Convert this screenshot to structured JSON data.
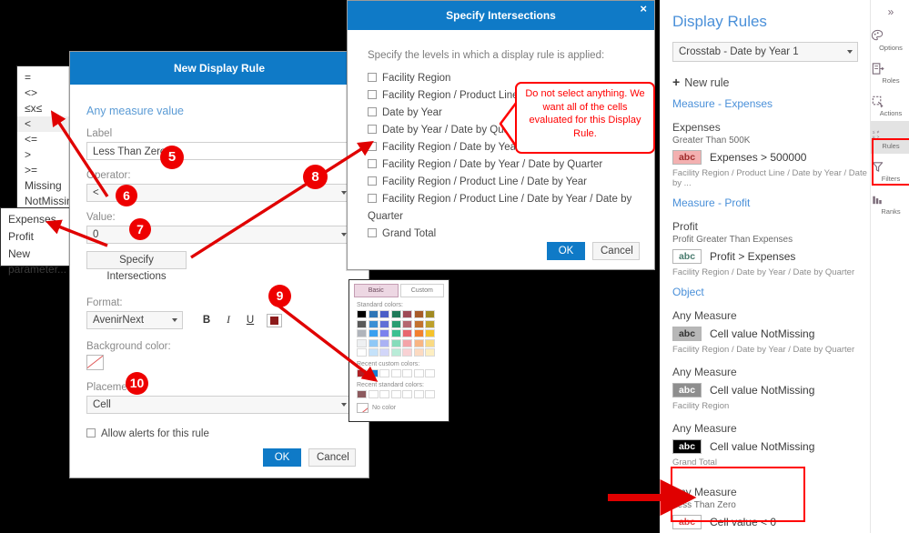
{
  "operator_dropdown": {
    "name": "Operator options",
    "options": [
      "=",
      "<>",
      "≤x≤",
      "<",
      "<=",
      ">",
      ">=",
      "Missing",
      "NotMissing"
    ],
    "selected": "<"
  },
  "value_dropdown": {
    "options": [
      "Expenses",
      "Profit",
      "New parameter..."
    ]
  },
  "new_display_rule": {
    "title": "New Display Rule",
    "any_measure_value": "Any measure value",
    "label_caption": "Label",
    "label_value": "Less Than Zero",
    "operator_caption": "Operator:",
    "operator_value": "<",
    "value_caption": "Value:",
    "value_value": "0",
    "specify_intersections_button": "Specify Intersections",
    "format_caption": "Format:",
    "font_value": "AvenirNext",
    "bold": "B",
    "italic": "I",
    "underline": "U",
    "font_color": "#8c1b1b",
    "background_caption": "Background color:",
    "background_value": "No color",
    "placement_caption": "Placement:",
    "placement_value": "Cell",
    "alerts_checkbox": "Allow alerts for this rule",
    "ok": "OK",
    "cancel": "Cancel"
  },
  "specify_intersections": {
    "title": "Specify Intersections",
    "close": "×",
    "instruction": "Specify the levels in which a display rule is applied:",
    "levels": [
      "Facility Region",
      "Facility Region / Product Line",
      "Date by Year",
      "Date by Year / Date by Quarter",
      "Facility Region / Date by Year",
      "Facility Region / Date by Year / Date by Quarter",
      "Facility Region / Product Line / Date by Year",
      "Facility Region / Product Line / Date by Year / Date by Quarter",
      "Grand Total"
    ],
    "ok": "OK",
    "cancel": "Cancel"
  },
  "callout": {
    "text": "Do not select anything.  We want all of the cells evaluated for this Display Rule.",
    "color": "#ff0000"
  },
  "color_picker": {
    "tab_basic": "Basic",
    "tab_custom": "Custom",
    "standard_caption": "Standard colors:",
    "standard_colors": [
      [
        "#000000",
        "#2e75b6",
        "#4a5ec7",
        "#1f7a5a",
        "#9e4a55",
        "#a75a28",
        "#a18a22"
      ],
      [
        "#595959",
        "#3b8fd4",
        "#5f6fd6",
        "#2a9c72",
        "#b4666f",
        "#c2712f",
        "#bda02c"
      ],
      [
        "#b0b4bb",
        "#3aa0f0",
        "#7b82ee",
        "#3cc091",
        "#e8666f",
        "#f2802f",
        "#f5c22b"
      ],
      [
        "#eef0f2",
        "#8fc8f6",
        "#aab2f4",
        "#86dcbb",
        "#f4a3a8",
        "#f8b583",
        "#f9da83"
      ],
      [
        "#ffffff",
        "#c5e2fa",
        "#d2d6f9",
        "#b9ecd8",
        "#f9d1d4",
        "#fcdac1",
        "#fdeec1"
      ]
    ],
    "recent_custom_caption": "Recent custom colors:",
    "recent_custom": [
      "#b01f24",
      "#1a7fd4",
      "",
      "",
      "",
      "",
      ""
    ],
    "recent_standard_caption": "Recent standard colors:",
    "recent_standard": [
      "#8c5a5e",
      "",
      "",
      "",
      "",
      "",
      ""
    ],
    "no_color": "No color"
  },
  "display_rules_panel": {
    "title": "Display Rules",
    "object_select": "Crosstab - Date by Year 1",
    "new_rule": "New rule",
    "groups": [
      {
        "header": "Measure - Expenses",
        "rules": [
          {
            "measure": "Expenses",
            "sub": "Greater Than 500K",
            "badge": "abc",
            "badge_bg": "#f3b0b0",
            "badge_fg": "#9e2a2a",
            "text": "Expenses > 500000",
            "path": "Facility Region / Product Line / Date by Year / Date by ..."
          }
        ]
      },
      {
        "header": "Measure - Profit",
        "rules": [
          {
            "measure": "Profit",
            "sub": "Profit Greater Than Expenses",
            "badge": "abc",
            "badge_bg": "#ffffff",
            "badge_fg": "#4a7c6f",
            "text": "Profit > Expenses",
            "path": "Facility Region / Date by Year / Date by Quarter"
          }
        ]
      },
      {
        "header": "Object",
        "rules": [
          {
            "measure": "Any Measure",
            "sub": "",
            "badge": "abc",
            "badge_bg": "#b7b7b7",
            "badge_fg": "#333333",
            "text": "Cell value NotMissing",
            "path": "Facility Region / Date by Year / Date by Quarter"
          },
          {
            "measure": "Any Measure",
            "sub": "",
            "badge": "abc",
            "badge_bg": "#8e8e8e",
            "badge_fg": "#ffffff",
            "text": "Cell value NotMissing",
            "path": "Facility Region"
          },
          {
            "measure": "Any Measure",
            "sub": "",
            "badge": "abc",
            "badge_bg": "#000000",
            "badge_fg": "#ffffff",
            "text": "Cell value NotMissing",
            "path": "Grand Total"
          },
          {
            "measure": "Any Measure",
            "sub": "Less Than Zero",
            "badge": "abc",
            "badge_bg": "#ffffff",
            "badge_fg": "#d04a4a",
            "text": "Cell value < 0",
            "path": ""
          }
        ]
      }
    ]
  },
  "rail": {
    "expand": "»",
    "items": [
      {
        "icon": "palette-icon",
        "label": "Options"
      },
      {
        "icon": "roles-icon",
        "label": "Roles"
      },
      {
        "icon": "actions-icon",
        "label": "Actions"
      },
      {
        "icon": "rules-icon",
        "label": "Rules"
      },
      {
        "icon": "filter-icon",
        "label": "Filters"
      },
      {
        "icon": "ranks-icon",
        "label": "Ranks"
      }
    ],
    "active": "Rules"
  },
  "badges": {
    "b5": "5",
    "b6": "6",
    "b7": "7",
    "b8": "8",
    "b9": "9",
    "b10": "10"
  }
}
